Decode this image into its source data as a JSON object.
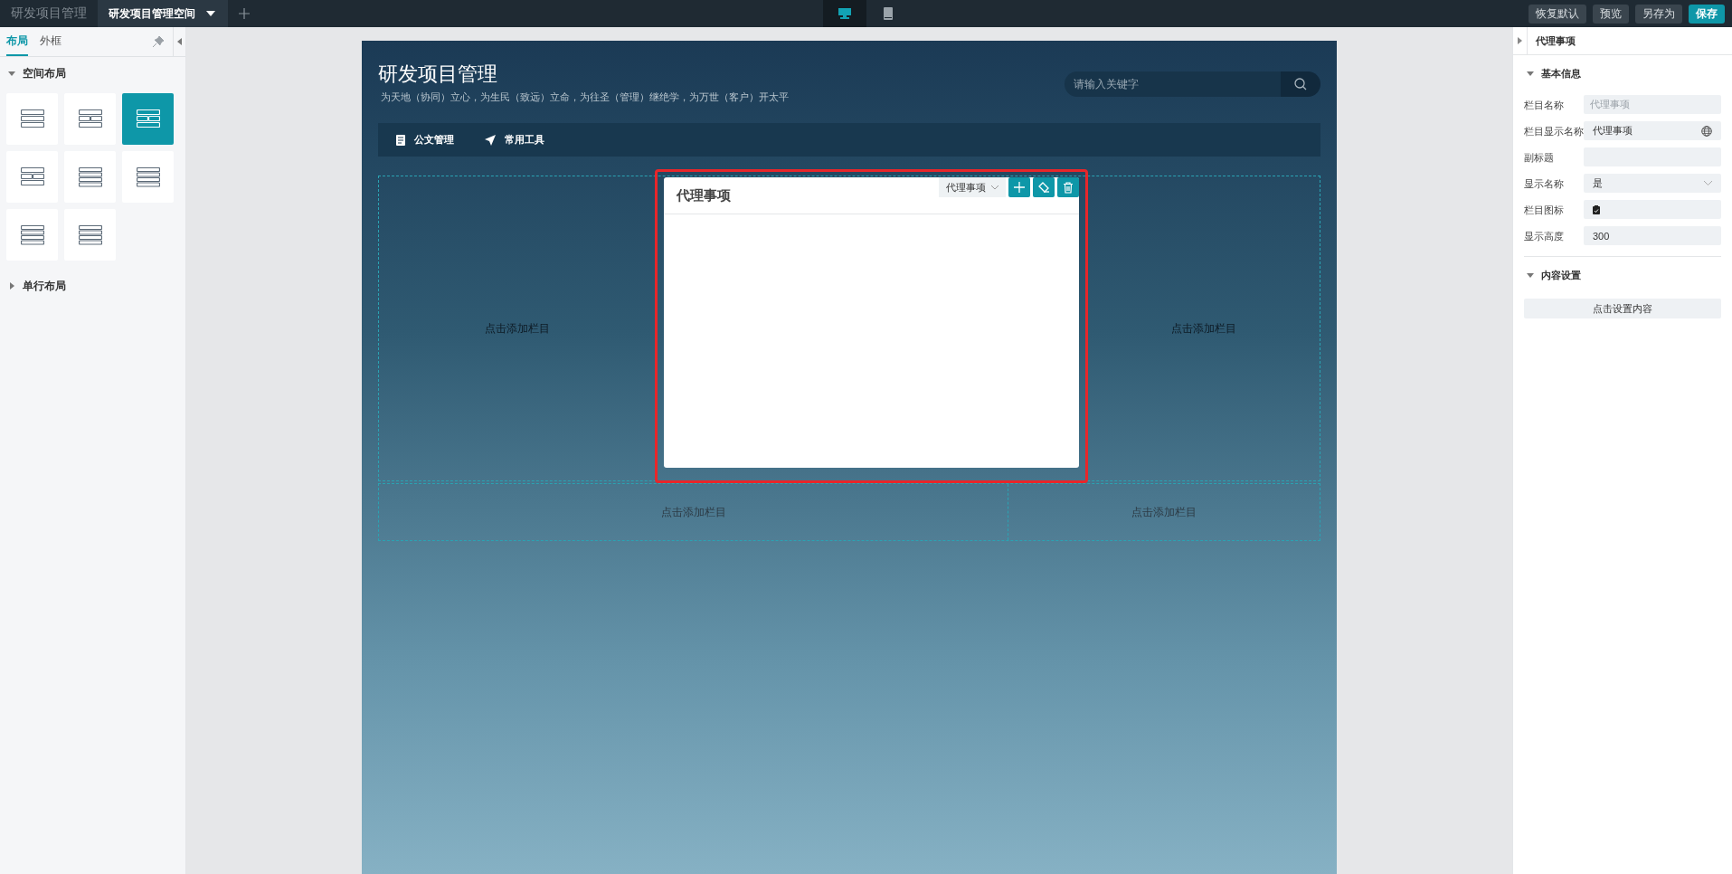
{
  "top_bar": {
    "app_title": "研发项目管理",
    "tabs": [
      {
        "label": "研发项目管理空间",
        "selected": true
      }
    ],
    "device_toggle": [
      {
        "kind": "desktop",
        "selected": true
      },
      {
        "kind": "mobile",
        "selected": false
      }
    ],
    "buttons": [
      {
        "label": "恢复默认",
        "primary": false
      },
      {
        "label": "预览",
        "primary": false
      },
      {
        "label": "另存为",
        "primary": false
      },
      {
        "label": "保存",
        "primary": true
      }
    ]
  },
  "left_panel": {
    "tabs": [
      {
        "label": "布局",
        "selected": true
      },
      {
        "label": "外框",
        "selected": false
      }
    ],
    "sections": [
      {
        "title": "空间布局",
        "expanded": true,
        "layouts": [
          {
            "kind": "rows",
            "selected": false
          },
          {
            "kind": "split2",
            "selected": false
          },
          {
            "kind": "split2",
            "selected": true
          },
          {
            "kind": "split21",
            "selected": false
          },
          {
            "kind": "split3",
            "selected": false
          },
          {
            "kind": "split3",
            "selected": false
          },
          {
            "kind": "split3b",
            "selected": false
          },
          {
            "kind": "split3b",
            "selected": false
          }
        ]
      },
      {
        "title": "单行布局",
        "expanded": false
      }
    ]
  },
  "canvas": {
    "site_title": "研发项目管理",
    "site_subtitle": "为天地（协同）立心，为生民（致远）立命，为往圣（管理）继绝学，为万世（客户）开太平",
    "search": {
      "placeholder": "请输入关键字"
    },
    "nav": [
      {
        "label": "公文管理",
        "kind": "document"
      },
      {
        "label": "常用工具",
        "kind": "send"
      }
    ],
    "rows": [
      {
        "slots": [
          {
            "kind": "empty",
            "label": "点击添加栏目"
          },
          {
            "kind": "portlet",
            "title": "代理事项",
            "selected": true,
            "toolbar_label": "代理事项"
          },
          {
            "kind": "empty",
            "label": "点击添加栏目"
          }
        ]
      },
      {
        "slots": [
          {
            "kind": "empty",
            "label": "点击添加栏目"
          },
          {
            "kind": "empty",
            "label": "点击添加栏目"
          }
        ]
      }
    ]
  },
  "props_panel": {
    "title": "代理事项",
    "sections": [
      {
        "title": "基本信息",
        "expanded": true,
        "fields": [
          {
            "label": "栏目名称",
            "kind": "text",
            "value": "代理事项",
            "disabled": true
          },
          {
            "label": "栏目显示名称",
            "kind": "i18n",
            "value": "代理事项",
            "disabled": false
          },
          {
            "label": "副标题",
            "kind": "text",
            "disabled": false
          },
          {
            "label": "显示名称",
            "kind": "select",
            "value": "是",
            "disabled": false
          },
          {
            "label": "栏目图标",
            "kind": "icon",
            "disabled": false
          },
          {
            "label": "显示高度",
            "kind": "text",
            "value": "300",
            "disabled": false
          }
        ]
      },
      {
        "title": "内容设置",
        "expanded": true,
        "button": "点击设置内容"
      }
    ]
  }
}
